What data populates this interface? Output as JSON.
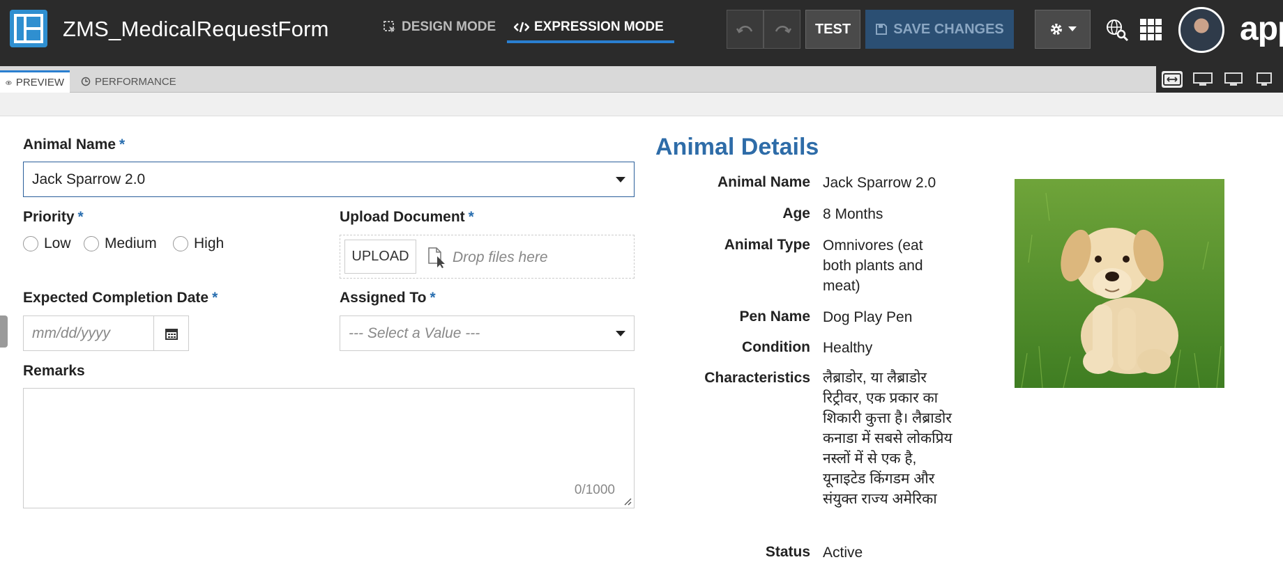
{
  "app": {
    "title": "ZMS_MedicalRequestForm",
    "design_mode": "DESIGN MODE",
    "expression_mode": "EXPRESSION MODE",
    "test_label": "TEST",
    "save_label": "SAVE CHANGES",
    "brand": "app"
  },
  "tabs": {
    "preview": "PREVIEW",
    "performance": "PERFORMANCE"
  },
  "form": {
    "animal_name_label": "Animal Name",
    "animal_name_value": "Jack Sparrow 2.0",
    "priority_label": "Priority",
    "priority_options": [
      "Low",
      "Medium",
      "High"
    ],
    "upload_label": "Upload Document",
    "upload_button": "UPLOAD",
    "drop_text": "Drop files here",
    "date_label": "Expected Completion Date",
    "date_placeholder": "mm/dd/yyyy",
    "assigned_label": "Assigned To",
    "assigned_placeholder": "--- Select a Value ---",
    "remarks_label": "Remarks",
    "remarks_counter": "0/1000",
    "required_mark": "*"
  },
  "details": {
    "title": "Animal Details",
    "rows": [
      {
        "label": "Animal Name",
        "value": "Jack Sparrow 2.0"
      },
      {
        "label": "Age",
        "value": "8 Months"
      },
      {
        "label": "Animal Type",
        "value": "Omnivores (eat both plants and meat)"
      },
      {
        "label": "Pen Name",
        "value": "Dog Play Pen"
      },
      {
        "label": "Condition",
        "value": "Healthy"
      },
      {
        "label": "Characteristics",
        "value": "लैब्राडोर, या लैब्राडोर रिट्रीवर, एक प्रकार का शिकारी कुत्ता है। लैब्राडोर कनाडा में सबसे लोकप्रिय नस्लों में से एक है, यूनाइटेड किंगडम और संयुक्त राज्य अमेरिका"
      },
      {
        "label": "Status",
        "value": "Active"
      }
    ]
  },
  "colors": {
    "topbar": "#2b2b2b",
    "accent": "#2a7fd0",
    "section_title": "#2e6ca8",
    "required": "#2a6fb0"
  }
}
